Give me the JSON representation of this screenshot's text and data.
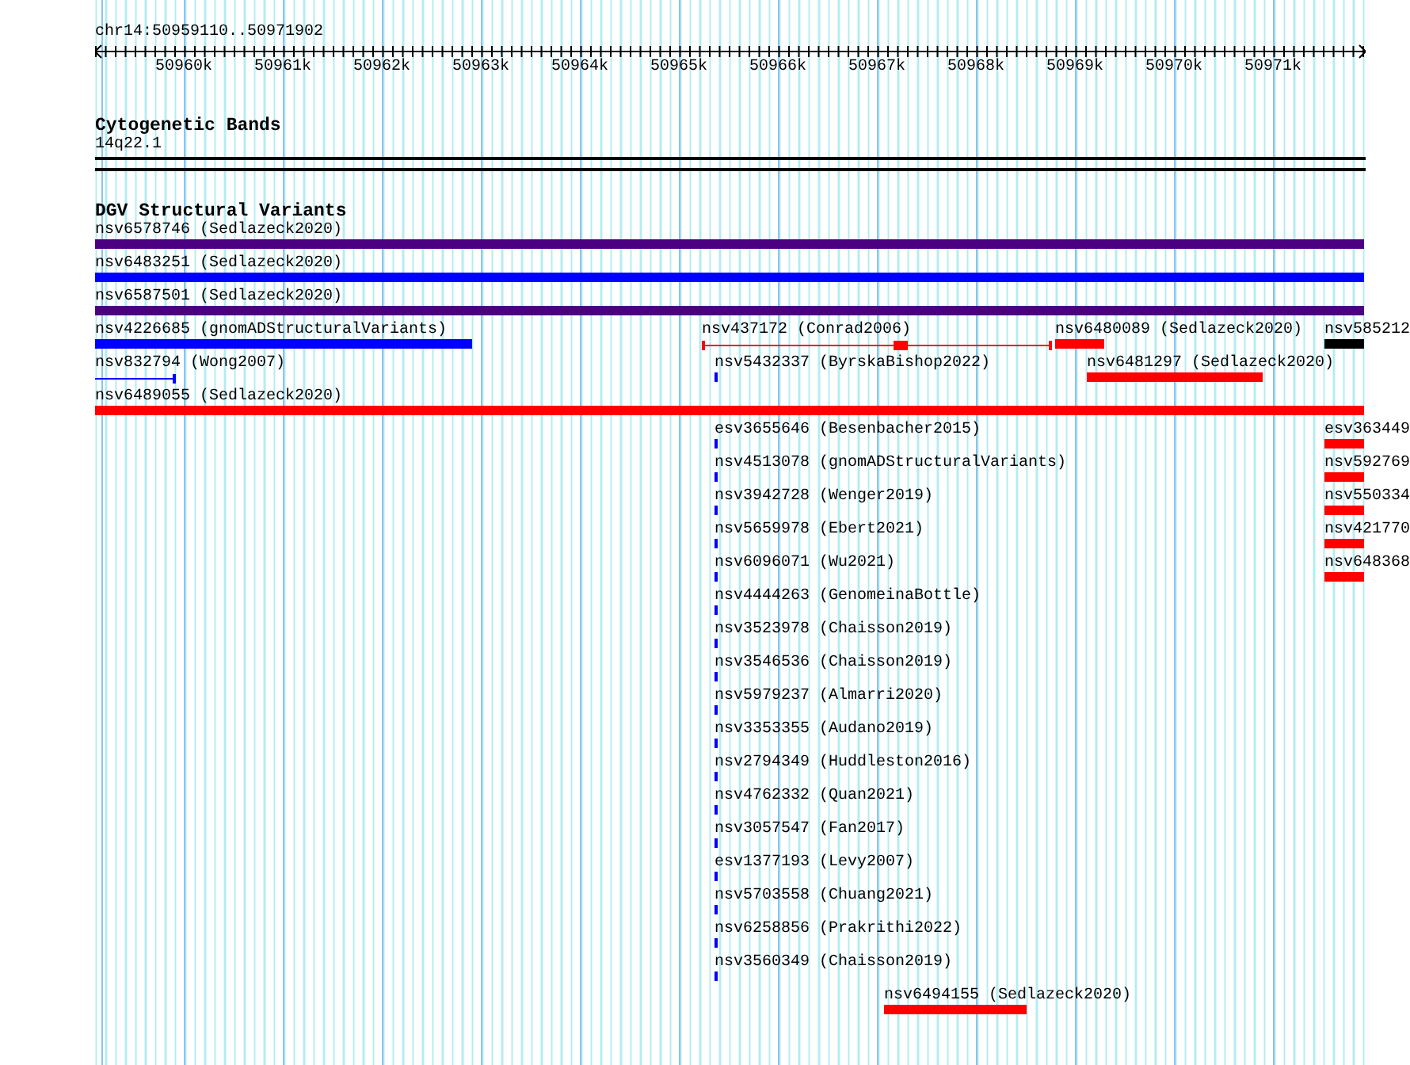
{
  "ruler": {
    "location": "chr14:50959110..50971902",
    "ticks": [
      "50960k",
      "50961k",
      "50962k",
      "50963k",
      "50964k",
      "50965k",
      "50966k",
      "50967k",
      "50968k",
      "50969k",
      "50970k",
      "50971k"
    ]
  },
  "cytogenetic_track": {
    "title": "Cytogenetic Bands",
    "band": "14q22.1"
  },
  "variants_track": {
    "title": "DGV Structural Variants",
    "features": [
      {
        "label": "nsv6578746 (Sedlazeck2020)",
        "kind": "bar",
        "color": "#4b0082"
      },
      {
        "label": "nsv6483251 (Sedlazeck2020)",
        "kind": "bar",
        "color": "#0000ff"
      },
      {
        "label": "nsv6587501 (Sedlazeck2020)",
        "kind": "bar",
        "color": "#4b0082"
      },
      {
        "label": "nsv4226685 (gnomADStructuralVariants)",
        "kind": "bar",
        "color": "#0000ff"
      },
      {
        "label": "nsv437172 (Conrad2006)",
        "kind": "span",
        "color": "#ff0000"
      },
      {
        "label": "nsv6480089 (Sedlazeck2020)",
        "kind": "bar",
        "color": "#ff0000"
      },
      {
        "label": "nsv585212",
        "kind": "bar",
        "color": "#000000"
      },
      {
        "label": "nsv832794 (Wong2007)",
        "kind": "span",
        "color": "#0000ff"
      },
      {
        "label": "nsv5432337 (ByrskaBishop2022)",
        "kind": "bar",
        "color": "#0000ff"
      },
      {
        "label": "nsv6481297 (Sedlazeck2020)",
        "kind": "bar",
        "color": "#ff0000"
      },
      {
        "label": "nsv6489055 (Sedlazeck2020)",
        "kind": "bar",
        "color": "#ff0000"
      },
      {
        "label": "esv3655646 (Besenbacher2015)",
        "kind": "bar",
        "color": "#0000ff"
      },
      {
        "label": "esv363449",
        "kind": "bar",
        "color": "#ff0000"
      },
      {
        "label": "nsv4513078 (gnomADStructuralVariants)",
        "kind": "bar",
        "color": "#0000ff"
      },
      {
        "label": "nsv592769",
        "kind": "bar",
        "color": "#ff0000"
      },
      {
        "label": "nsv3942728 (Wenger2019)",
        "kind": "bar",
        "color": "#0000ff"
      },
      {
        "label": "nsv550334",
        "kind": "bar",
        "color": "#ff0000"
      },
      {
        "label": "nsv5659978 (Ebert2021)",
        "kind": "bar",
        "color": "#0000ff"
      },
      {
        "label": "nsv421770",
        "kind": "bar",
        "color": "#ff0000"
      },
      {
        "label": "nsv6096071 (Wu2021)",
        "kind": "bar",
        "color": "#0000ff"
      },
      {
        "label": "nsv648368",
        "kind": "bar",
        "color": "#ff0000"
      },
      {
        "label": "nsv4444263 (GenomeinaBottle)",
        "kind": "bar",
        "color": "#0000ff"
      },
      {
        "label": "nsv3523978 (Chaisson2019)",
        "kind": "bar",
        "color": "#0000ff"
      },
      {
        "label": "nsv3546536 (Chaisson2019)",
        "kind": "bar",
        "color": "#0000ff"
      },
      {
        "label": "nsv5979237 (Almarri2020)",
        "kind": "bar",
        "color": "#0000ff"
      },
      {
        "label": "nsv3353355 (Audano2019)",
        "kind": "bar",
        "color": "#0000ff"
      },
      {
        "label": "nsv2794349 (Huddleston2016)",
        "kind": "bar",
        "color": "#0000ff"
      },
      {
        "label": "nsv4762332 (Quan2021)",
        "kind": "bar",
        "color": "#0000ff"
      },
      {
        "label": "nsv3057547 (Fan2017)",
        "kind": "bar",
        "color": "#0000ff"
      },
      {
        "label": "esv1377193 (Levy2007)",
        "kind": "bar",
        "color": "#0000ff"
      },
      {
        "label": "nsv5703558 (Chuang2021)",
        "kind": "bar",
        "color": "#0000ff"
      },
      {
        "label": "nsv6258856 (Prakrithi2022)",
        "kind": "bar",
        "color": "#0000ff"
      },
      {
        "label": "nsv3560349 (Chaisson2019)",
        "kind": "bar",
        "color": "#0000ff"
      },
      {
        "label": "nsv6494155 (Sedlazeck2020)",
        "kind": "bar",
        "color": "#ff0000"
      }
    ]
  }
}
